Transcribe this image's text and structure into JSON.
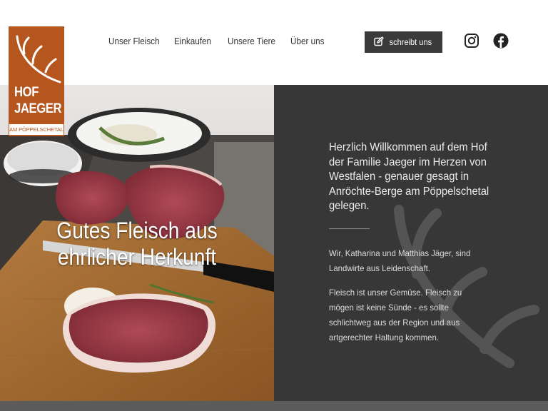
{
  "logo": {
    "line1": "HOF",
    "line2": "JAEGER",
    "subline": "AM PÖPPELSCHETAL",
    "color": "#b5561f"
  },
  "nav": {
    "items": [
      {
        "label": "Unser Fleisch"
      },
      {
        "label": "Einkaufen"
      },
      {
        "label": "Unsere Tiere"
      },
      {
        "label": "Über uns"
      }
    ],
    "cta_label": "schreibt uns",
    "cta_icon": "edit-icon",
    "social": [
      "instagram-icon",
      "facebook-icon"
    ]
  },
  "hero": {
    "title_line1": "Gutes Fleisch aus",
    "title_line2": "ehrlicher Herkunft",
    "image": "raw-steaks-on-cutting-board"
  },
  "intro": {
    "heading": "Herzlich Willkommen auf dem Hof der Familie Jaeger im Herzen von Westfalen - genauer gesagt in Anröchte-Berge am Pöppelschetal gelegen.",
    "para1": "Wir, Katharina und Matthias Jäger, sind Landwirte aus Leidenschaft.",
    "para2": "Fleisch ist unser Gemüse. Fleisch zu mögen ist keine Sünde - es sollte schlichtweg aus der Region und aus artgerechter Haltung kommen."
  },
  "colors": {
    "dark_panel": "#373737",
    "cta_bg": "#3a3a3a",
    "accent": "#b5561f"
  }
}
